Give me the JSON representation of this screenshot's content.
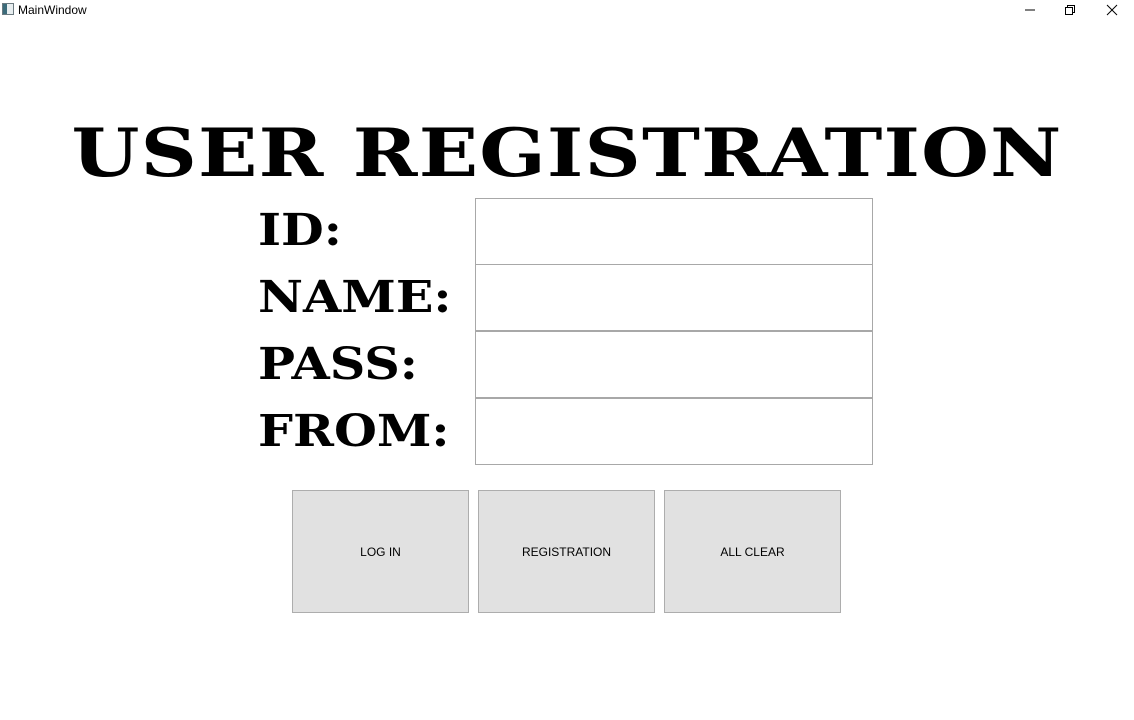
{
  "window": {
    "title": "MainWindow",
    "controls": {
      "minimize_icon": "minimize-icon",
      "maximize_icon": "restore-icon",
      "close_icon": "close-icon"
    }
  },
  "main": {
    "heading": "USER REGISTRATION",
    "fields": [
      {
        "label": "ID:",
        "value": ""
      },
      {
        "label": "NAME:",
        "value": ""
      },
      {
        "label": "PASS:",
        "value": ""
      },
      {
        "label": "FROM:",
        "value": ""
      }
    ],
    "buttons": {
      "login": "LOG IN",
      "registration": "REGISTRATION",
      "all_clear": "ALL CLEAR"
    }
  },
  "colors": {
    "button_bg": "#e1e1e1",
    "button_border": "#adadad",
    "input_border": "#a8a8a8",
    "text": "#000000"
  }
}
